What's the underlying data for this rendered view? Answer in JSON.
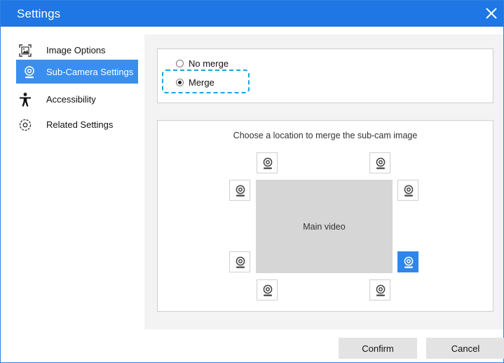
{
  "window": {
    "title": "Settings",
    "close_icon": "close-icon"
  },
  "sidebar": {
    "items": [
      {
        "label": "Image Options",
        "icon": "image-options-icon",
        "active": false
      },
      {
        "label": "Sub-Camera Settings",
        "icon": "webcam-icon",
        "active": true
      },
      {
        "label": "Accessibility",
        "icon": "accessibility-icon",
        "active": false
      },
      {
        "label": "Related Settings",
        "icon": "gear-icon",
        "active": false
      }
    ]
  },
  "merge_mode": {
    "options": [
      {
        "label": "No merge",
        "selected": false
      },
      {
        "label": "Merge",
        "selected": true
      }
    ]
  },
  "merge_location": {
    "caption": "Choose a location to merge the sub-cam image",
    "main_video_label": "Main video",
    "positions": [
      {
        "id": "top-left",
        "selected": false
      },
      {
        "id": "top-right",
        "selected": false
      },
      {
        "id": "left-upper",
        "selected": false
      },
      {
        "id": "right-upper",
        "selected": false
      },
      {
        "id": "left-lower",
        "selected": false
      },
      {
        "id": "right-lower",
        "selected": true
      },
      {
        "id": "bottom-left",
        "selected": false
      },
      {
        "id": "bottom-right",
        "selected": false
      }
    ]
  },
  "footer": {
    "confirm_label": "Confirm",
    "cancel_label": "Cancel"
  },
  "colors": {
    "accent": "#1e77e4",
    "selected": "#2f86ea",
    "focus": "#1aa3e0"
  }
}
